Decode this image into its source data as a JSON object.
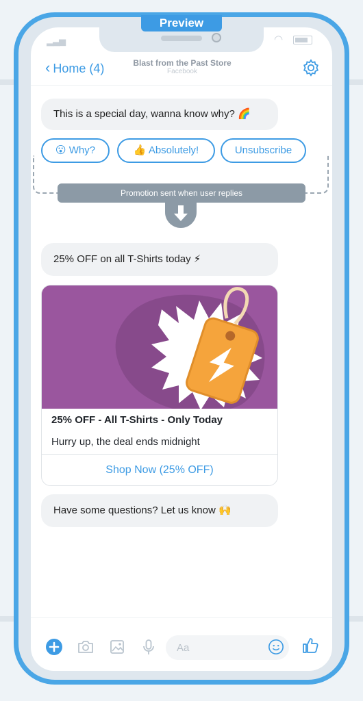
{
  "preview_label": "Preview",
  "header": {
    "back_label": "Home (4)",
    "store_name": "Blast from the Past Store",
    "platform": "Facebook"
  },
  "messages": {
    "greeting": "This is a special day, wanna know why? 🌈",
    "quick_replies": [
      {
        "label": "😮 Why?"
      },
      {
        "label": "👍 Absolutely!"
      },
      {
        "label": "Unsubscribe"
      }
    ],
    "promotion_note": "Promotion sent when user replies",
    "promo_text": "25% OFF on all T-Shirts today ⚡",
    "card": {
      "title": "25% OFF - All T-Shirts - Only Today",
      "subtitle": "Hurry up, the deal ends midnight",
      "button": "Shop Now (25% OFF)"
    },
    "closing": "Have some questions? Let us know 🙌"
  },
  "composer": {
    "placeholder": "Aa",
    "icons": [
      "plus-icon",
      "camera-icon",
      "image-icon",
      "microphone-icon",
      "emoji-icon",
      "thumbs-up-icon"
    ]
  },
  "colors": {
    "accent": "#3d9be4",
    "card_image_bg": "#9a569e",
    "tag_orange": "#f5a43c"
  }
}
